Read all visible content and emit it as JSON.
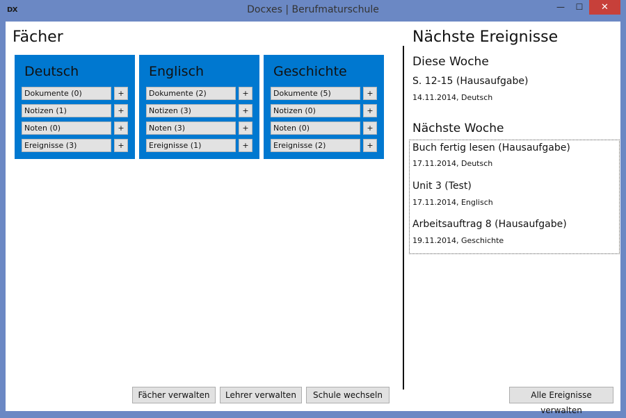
{
  "window": {
    "app_icon": "DX",
    "title": "Docxes | Berufmaturschule",
    "minimize_icon": "minimize-icon",
    "maximize_icon": "maximize-icon",
    "close_icon": "close-icon",
    "minimize_glyph": "—",
    "maximize_glyph": "☐",
    "close_glyph": "✕"
  },
  "subjects": {
    "heading": "Fächer",
    "cards": [
      {
        "name": "Deutsch",
        "rows": [
          {
            "label": "Dokumente (0)",
            "plus": "+"
          },
          {
            "label": "Notizen (1)",
            "plus": "+"
          },
          {
            "label": "Noten (0)",
            "plus": "+"
          },
          {
            "label": "Ereignisse (3)",
            "plus": "+"
          }
        ]
      },
      {
        "name": "Englisch",
        "rows": [
          {
            "label": "Dokumente (2)",
            "plus": "+"
          },
          {
            "label": "Notizen (3)",
            "plus": "+"
          },
          {
            "label": "Noten (3)",
            "plus": "+"
          },
          {
            "label": "Ereignisse (1)",
            "plus": "+"
          }
        ]
      },
      {
        "name": "Geschichte",
        "rows": [
          {
            "label": "Dokumente (5)",
            "plus": "+"
          },
          {
            "label": "Notizen (0)",
            "plus": "+"
          },
          {
            "label": "Noten (0)",
            "plus": "+"
          },
          {
            "label": "Ereignisse (2)",
            "plus": "+"
          }
        ]
      }
    ],
    "buttons": {
      "manage_subjects": "Fächer verwalten",
      "manage_teachers": "Lehrer verwalten",
      "change_school": "Schule wechseln"
    }
  },
  "events": {
    "heading": "Nächste Ereignisse",
    "this_week": {
      "heading": "Diese Woche",
      "items": [
        {
          "title": "S. 12-15 (Hausaufgabe)",
          "meta": "14.11.2014, Deutsch"
        }
      ]
    },
    "next_week": {
      "heading": "Nächste Woche",
      "items": [
        {
          "title": "Buch fertig lesen (Hausaufgabe)",
          "meta": "17.11.2014, Deutsch"
        },
        {
          "title": "Unit 3 (Test)",
          "meta": "17.11.2014, Englisch"
        },
        {
          "title": "Arbeitsauftrag 8 (Hausaufgabe)",
          "meta": "19.11.2014, Geschichte"
        }
      ]
    },
    "manage_all_button": "Alle Ereignisse verwalten"
  }
}
